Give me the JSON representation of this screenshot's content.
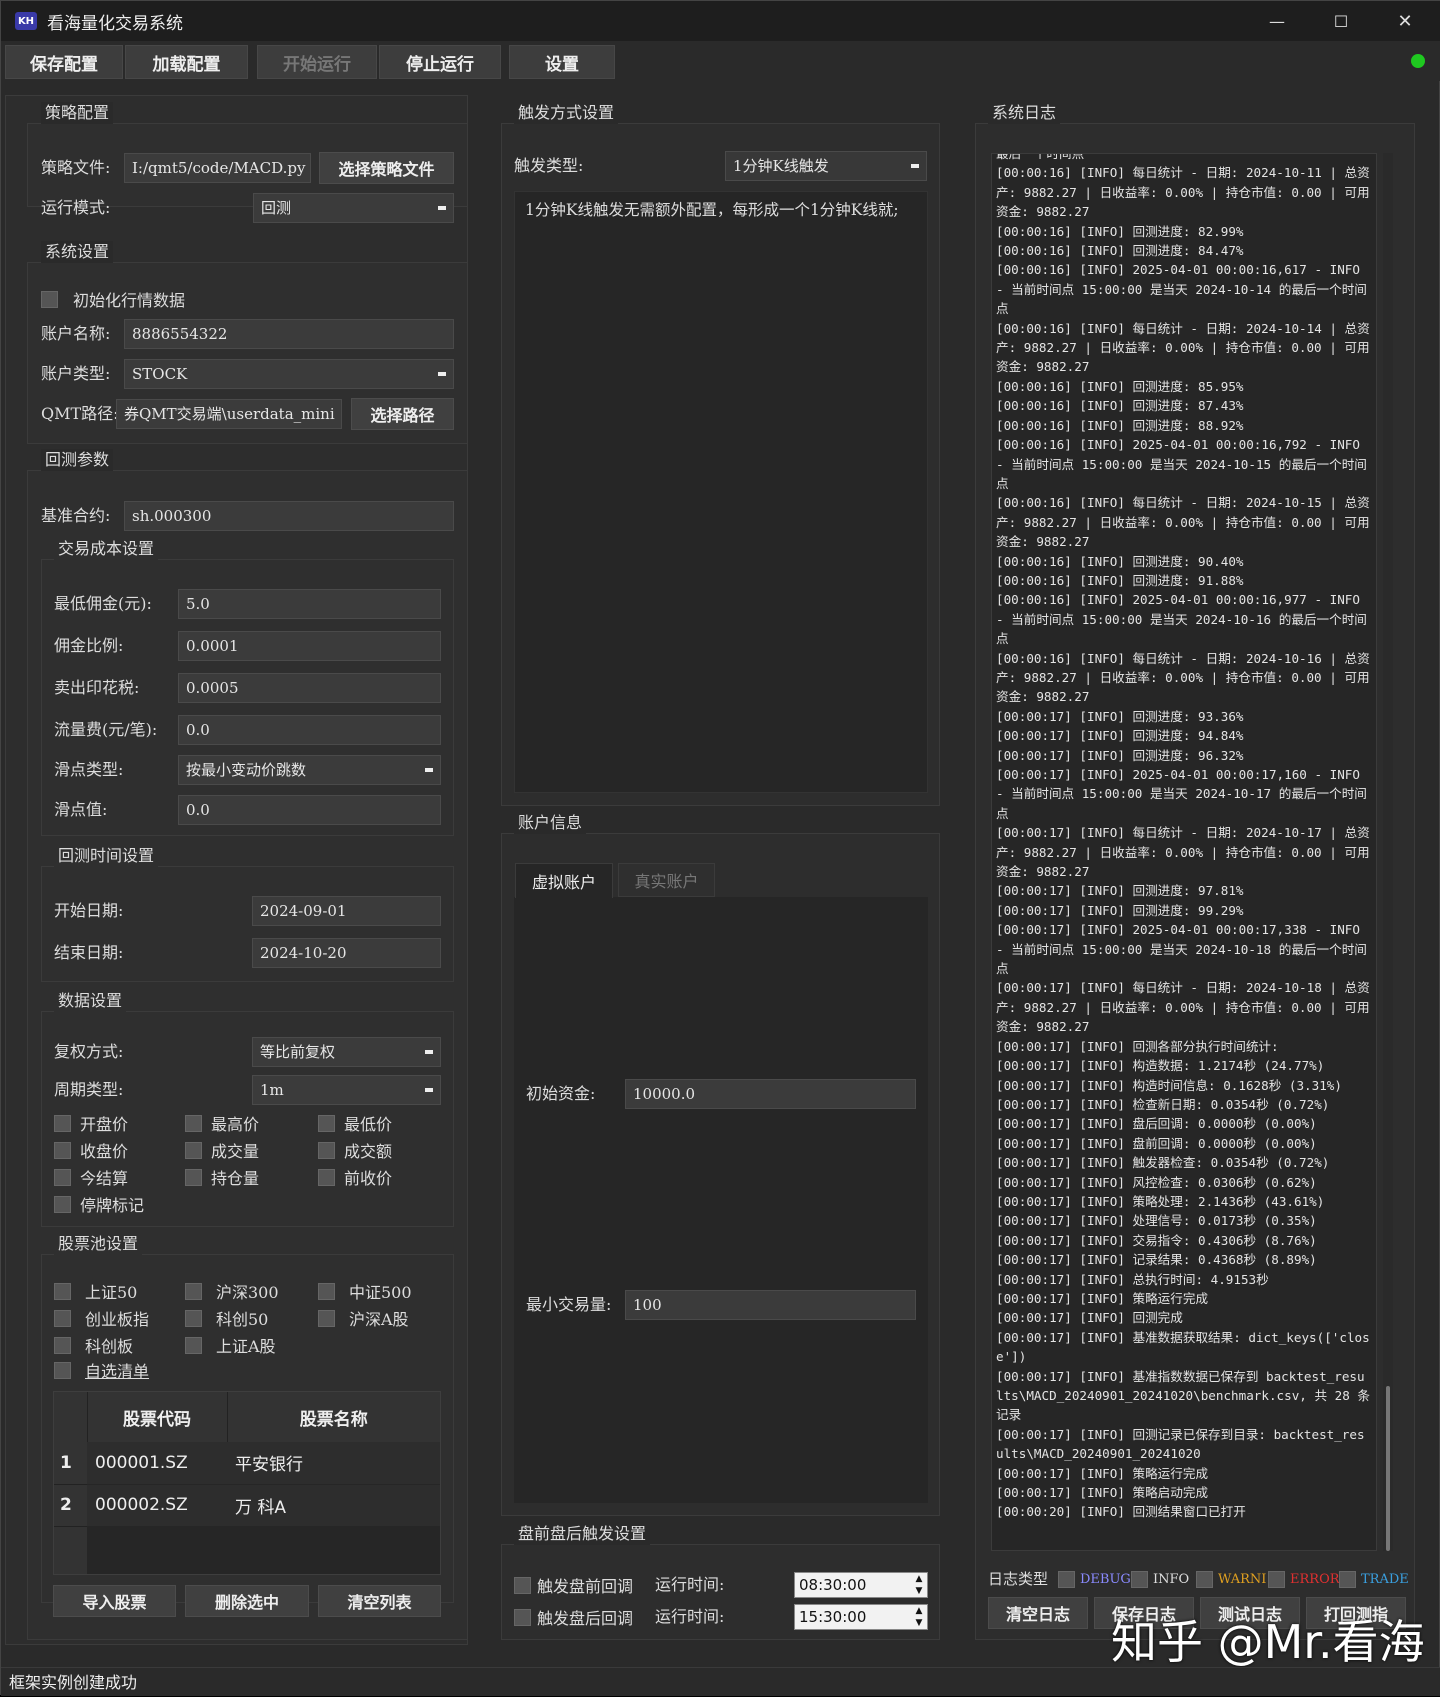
{
  "app": {
    "title": "看海量化交易系统",
    "logo": "KH"
  },
  "window": {
    "minimize": "—",
    "maximize": "☐",
    "close": "✕"
  },
  "toolbar": {
    "save": "保存配置",
    "load": "加载配置",
    "start": "开始运行",
    "stop": "停止运行",
    "settings": "设置",
    "status_color": "#1fc820"
  },
  "strategy": {
    "title": "策略配置",
    "file_label": "策略文件:",
    "file_value": "I:/qmt5/code/MACD.py",
    "choose_file": "选择策略文件",
    "mode_label": "运行模式:",
    "mode_value": "回测"
  },
  "system": {
    "title": "系统设置",
    "init_data": "初始化行情数据",
    "account_name_label": "账户名称:",
    "account_name": "8886554322",
    "account_type_label": "账户类型:",
    "account_type": "STOCK",
    "qmt_label": "QMT路径:",
    "qmt_path": "券QMT交易端\\userdata_mini",
    "choose_path": "选择路径"
  },
  "backtest": {
    "title": "回测参数",
    "benchmark_label": "基准合约:",
    "benchmark": "sh.000300",
    "cost": {
      "title": "交易成本设置",
      "min_comm_label": "最低佣金(元):",
      "min_comm": "5.0",
      "comm_rate_label": "佣金比例:",
      "comm_rate": "0.0001",
      "stamp_label": "卖出印花税:",
      "stamp": "0.0005",
      "flow_label": "流量费(元/笔):",
      "flow": "0.0",
      "slip_type_label": "滑点类型:",
      "slip_type": "按最小变动价跳数",
      "slip_val_label": "滑点值:",
      "slip_val": "0.0"
    },
    "time": {
      "title": "回测时间设置",
      "start_label": "开始日期:",
      "start": "2024-09-01",
      "end_label": "结束日期:",
      "end": "2024-10-20"
    },
    "data": {
      "title": "数据设置",
      "adjust_label": "复权方式:",
      "adjust": "等比前复权",
      "period_label": "周期类型:",
      "period": "1m",
      "fields": [
        "开盘价",
        "最高价",
        "最低价",
        "收盘价",
        "成交量",
        "成交额",
        "今结算",
        "持仓量",
        "前收价",
        "停牌标记"
      ]
    },
    "pool": {
      "title": "股票池设置",
      "items": [
        "上证50",
        "沪深300",
        "中证500",
        "创业板指",
        "科创50",
        "沪深A股",
        "科创板",
        "上证A股"
      ],
      "custom": "自选清单",
      "col_code": "股票代码",
      "col_name": "股票名称",
      "rows": [
        {
          "idx": "1",
          "code": "000001.SZ",
          "name": "平安银行"
        },
        {
          "idx": "2",
          "code": "000002.SZ",
          "name": "万 科A"
        }
      ],
      "import": "导入股票",
      "delete": "删除选中",
      "clear": "清空列表"
    }
  },
  "trigger": {
    "title": "触发方式设置",
    "type_label": "触发类型:",
    "type_value": "1分钟K线触发",
    "desc": "1分钟K线触发无需额外配置，每形成一个1分钟K线就;"
  },
  "account": {
    "title": "账户信息",
    "tab_virtual": "虚拟账户",
    "tab_real": "真实账户",
    "capital_label": "初始资金:",
    "capital": "10000.0",
    "min_vol_label": "最小交易量:",
    "min_vol": "100"
  },
  "prepost": {
    "title": "盘前盘后触发设置",
    "pre": "触发盘前回调",
    "post": "触发盘后回调",
    "time_label": "运行时间:",
    "pre_time": "08:30:00",
    "post_time": "15:30:00"
  },
  "log": {
    "title": "系统日志",
    "text": "最后一个时间点\n[00:00:16] [INFO] 每日统计 - 日期: 2024-10-11 | 总资产: 9882.27 | 日收益率: 0.00% | 持仓市值: 0.00 | 可用资金: 9882.27\n[00:00:16] [INFO] 回测进度: 82.99%\n[00:00:16] [INFO] 回测进度: 84.47%\n[00:00:16] [INFO] 2025-04-01 00:00:16,617 - INFO - 当前时间点 15:00:00 是当天 2024-10-14 的最后一个时间点\n[00:00:16] [INFO] 每日统计 - 日期: 2024-10-14 | 总资产: 9882.27 | 日收益率: 0.00% | 持仓市值: 0.00 | 可用资金: 9882.27\n[00:00:16] [INFO] 回测进度: 85.95%\n[00:00:16] [INFO] 回测进度: 87.43%\n[00:00:16] [INFO] 回测进度: 88.92%\n[00:00:16] [INFO] 2025-04-01 00:00:16,792 - INFO - 当前时间点 15:00:00 是当天 2024-10-15 的最后一个时间点\n[00:00:16] [INFO] 每日统计 - 日期: 2024-10-15 | 总资产: 9882.27 | 日收益率: 0.00% | 持仓市值: 0.00 | 可用资金: 9882.27\n[00:00:16] [INFO] 回测进度: 90.40%\n[00:00:16] [INFO] 回测进度: 91.88%\n[00:00:16] [INFO] 2025-04-01 00:00:16,977 - INFO - 当前时间点 15:00:00 是当天 2024-10-16 的最后一个时间点\n[00:00:16] [INFO] 每日统计 - 日期: 2024-10-16 | 总资产: 9882.27 | 日收益率: 0.00% | 持仓市值: 0.00 | 可用资金: 9882.27\n[00:00:17] [INFO] 回测进度: 93.36%\n[00:00:17] [INFO] 回测进度: 94.84%\n[00:00:17] [INFO] 回测进度: 96.32%\n[00:00:17] [INFO] 2025-04-01 00:00:17,160 - INFO - 当前时间点 15:00:00 是当天 2024-10-17 的最后一个时间点\n[00:00:17] [INFO] 每日统计 - 日期: 2024-10-17 | 总资产: 9882.27 | 日收益率: 0.00% | 持仓市值: 0.00 | 可用资金: 9882.27\n[00:00:17] [INFO] 回测进度: 97.81%\n[00:00:17] [INFO] 回测进度: 99.29%\n[00:00:17] [INFO] 2025-04-01 00:00:17,338 - INFO - 当前时间点 15:00:00 是当天 2024-10-18 的最后一个时间点\n[00:00:17] [INFO] 每日统计 - 日期: 2024-10-18 | 总资产: 9882.27 | 日收益率: 0.00% | 持仓市值: 0.00 | 可用资金: 9882.27\n[00:00:17] [INFO] 回测各部分执行时间统计:\n[00:00:17] [INFO] 构造数据: 1.2174秒 (24.77%)\n[00:00:17] [INFO] 构造时间信息: 0.1628秒 (3.31%)\n[00:00:17] [INFO] 检查新日期: 0.0354秒 (0.72%)\n[00:00:17] [INFO] 盘后回调: 0.0000秒 (0.00%)\n[00:00:17] [INFO] 盘前回调: 0.0000秒 (0.00%)\n[00:00:17] [INFO] 触发器检查: 0.0354秒 (0.72%)\n[00:00:17] [INFO] 风控检查: 0.0306秒 (0.62%)\n[00:00:17] [INFO] 策略处理: 2.1436秒 (43.61%)\n[00:00:17] [INFO] 处理信号: 0.0173秒 (0.35%)\n[00:00:17] [INFO] 交易指令: 0.4306秒 (8.76%)\n[00:00:17] [INFO] 记录结果: 0.4368秒 (8.89%)\n[00:00:17] [INFO] 总执行时间: 4.9153秒\n[00:00:17] [INFO] 策略运行完成\n[00:00:17] [INFO] 回测完成\n[00:00:17] [INFO] 基准数据获取结果: dict_keys(['close'])\n[00:00:17] [INFO] 基准指数数据已保存到 backtest_results\\MACD_20240901_20241020\\benchmark.csv, 共 28 条记录\n[00:00:17] [INFO] 回测记录已保存到目录: backtest_results\\MACD_20240901_20241020\n[00:00:17] [INFO] 策略运行完成\n[00:00:17] [INFO] 策略启动完成\n[00:00:20] [INFO] 回测结果窗口已打开",
    "type_label": "日志类型",
    "types": [
      {
        "name": "DEBUG",
        "color": "#8a8aff"
      },
      {
        "name": "INFO",
        "color": "#dddddd"
      },
      {
        "name": "WARNI",
        "color": "#e0a020"
      },
      {
        "name": "ERROR",
        "color": "#e03030"
      },
      {
        "name": "TRADE",
        "color": "#3aa0e0"
      }
    ],
    "clear": "清空日志",
    "save": "保存日志",
    "test": "测试日志",
    "report": "打回测指"
  },
  "watermark": "知乎 @Mr.看海",
  "status": "框架实例创建成功"
}
